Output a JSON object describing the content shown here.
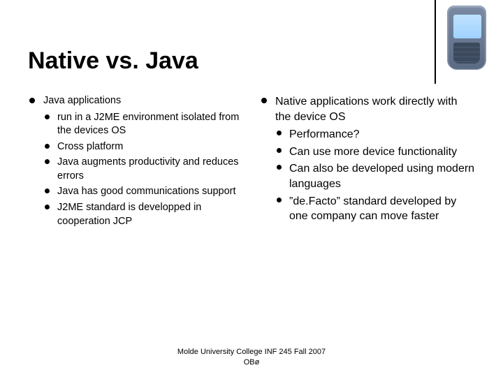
{
  "title": "Native vs. Java",
  "left": {
    "heading": "Java applications",
    "items": [
      "run in a J2ME environment isolated from the devices OS",
      "Cross platform",
      "Java augments productivity and reduces errors",
      "Java has good communications support",
      "J2ME standard is developped in cooperation JCP"
    ]
  },
  "right": {
    "heading": "Native applications work directly with the device OS",
    "items": [
      "Performance?",
      "Can use more device functionality",
      "Can also be developed using modern languages",
      "”de.Facto” standard developed by one company can move faster"
    ]
  },
  "footer": {
    "line1": "Molde University College INF 245 Fall 2007",
    "line2": "OBø"
  },
  "phone_icon": "mobile-phone-icon"
}
